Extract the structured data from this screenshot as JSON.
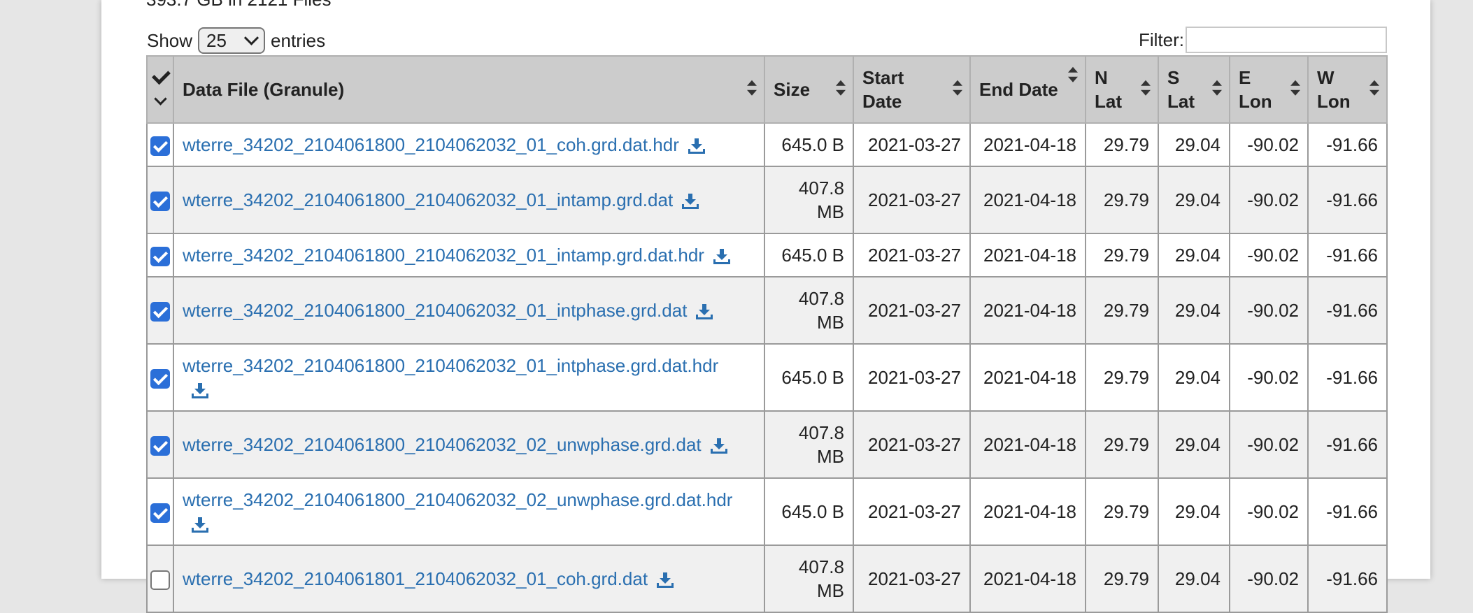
{
  "summary_text": "393.7 GB in 2121 Files",
  "controls": {
    "show_label": "Show",
    "entries_value": "25",
    "entries_label": "entries",
    "filter_label": "Filter:"
  },
  "table": {
    "headers": {
      "file": "Data File (Granule)",
      "size": "Size",
      "start": "Start Date",
      "end": "End Date",
      "nlat": "N Lat",
      "slat": "S Lat",
      "elon": "E Lon",
      "wlon": "W Lon"
    },
    "rows": [
      {
        "checked": true,
        "name": "wterre_34202_2104061800_2104062032_01_coh.grd.dat.hdr",
        "size": "645.0 B",
        "start": "2021-03-27",
        "end": "2021-04-18",
        "nlat": "29.79",
        "slat": "29.04",
        "elon": "-90.02",
        "wlon": "-91.66"
      },
      {
        "checked": true,
        "name": "wterre_34202_2104061800_2104062032_01_intamp.grd.dat",
        "size": "407.8 MB",
        "start": "2021-03-27",
        "end": "2021-04-18",
        "nlat": "29.79",
        "slat": "29.04",
        "elon": "-90.02",
        "wlon": "-91.66"
      },
      {
        "checked": true,
        "name": "wterre_34202_2104061800_2104062032_01_intamp.grd.dat.hdr",
        "size": "645.0 B",
        "start": "2021-03-27",
        "end": "2021-04-18",
        "nlat": "29.79",
        "slat": "29.04",
        "elon": "-90.02",
        "wlon": "-91.66"
      },
      {
        "checked": true,
        "name": "wterre_34202_2104061800_2104062032_01_intphase.grd.dat",
        "size": "407.8 MB",
        "start": "2021-03-27",
        "end": "2021-04-18",
        "nlat": "29.79",
        "slat": "29.04",
        "elon": "-90.02",
        "wlon": "-91.66"
      },
      {
        "checked": true,
        "name": "wterre_34202_2104061800_2104062032_01_intphase.grd.dat.hdr",
        "size": "645.0 B",
        "start": "2021-03-27",
        "end": "2021-04-18",
        "nlat": "29.79",
        "slat": "29.04",
        "elon": "-90.02",
        "wlon": "-91.66"
      },
      {
        "checked": true,
        "name": "wterre_34202_2104061800_2104062032_02_unwphase.grd.dat",
        "size": "407.8 MB",
        "start": "2021-03-27",
        "end": "2021-04-18",
        "nlat": "29.79",
        "slat": "29.04",
        "elon": "-90.02",
        "wlon": "-91.66"
      },
      {
        "checked": true,
        "name": "wterre_34202_2104061800_2104062032_02_unwphase.grd.dat.hdr",
        "size": "645.0 B",
        "start": "2021-03-27",
        "end": "2021-04-18",
        "nlat": "29.79",
        "slat": "29.04",
        "elon": "-90.02",
        "wlon": "-91.66"
      },
      {
        "checked": false,
        "name": "wterre_34202_2104061801_2104062032_01_coh.grd.dat",
        "size": "407.8 MB",
        "start": "2021-03-27",
        "end": "2021-04-18",
        "nlat": "29.79",
        "slat": "29.04",
        "elon": "-90.02",
        "wlon": "-91.66"
      }
    ]
  },
  "icons": {
    "download": "download-icon",
    "sort": "sort-icon",
    "select_all": "check-icon"
  },
  "colors": {
    "link": "#2a6fb0",
    "checkbox": "#2b6fd8",
    "header_bg": "#cccccc",
    "row_alt": "#f0f0f0"
  }
}
